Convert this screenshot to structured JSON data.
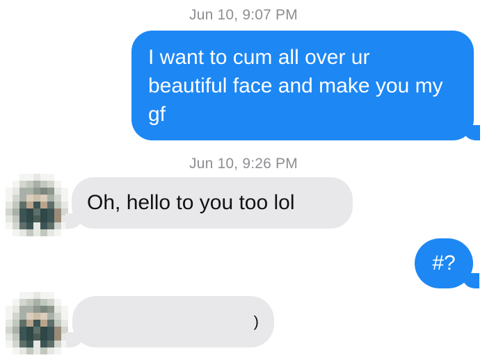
{
  "thread": {
    "timestamps": [
      "Jun 10, 9:07 PM",
      "Jun 10, 9:26 PM"
    ],
    "messages": [
      {
        "direction": "sent",
        "text": "I want to cum all over ur beautiful face and make you my gf"
      },
      {
        "direction": "received",
        "text": "Oh, hello to you too lol"
      },
      {
        "direction": "sent",
        "text": "#?"
      },
      {
        "direction": "received",
        "text": ""
      }
    ]
  },
  "colors": {
    "sent_bubble": "#1d87f4",
    "received_bubble": "#e8e8eb",
    "timestamp": "#8e8e93"
  },
  "avatars": [
    {
      "icon": "pixelated-avatar-icon"
    },
    {
      "icon": "pixelated-avatar-icon"
    }
  ]
}
